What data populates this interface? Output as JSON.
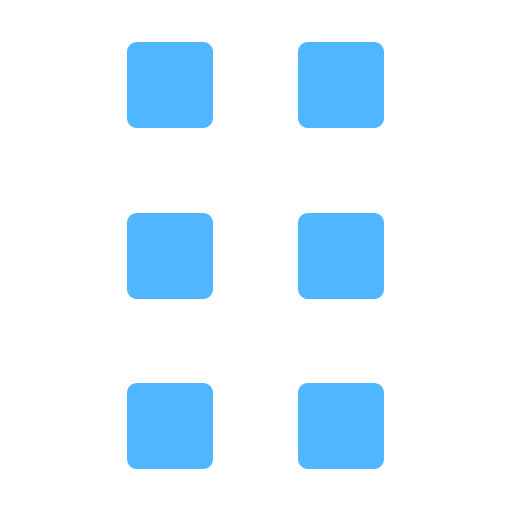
{
  "icon": {
    "name": "grid-icon",
    "color": "#4FB6FF",
    "rows": 3,
    "columns": 2
  }
}
